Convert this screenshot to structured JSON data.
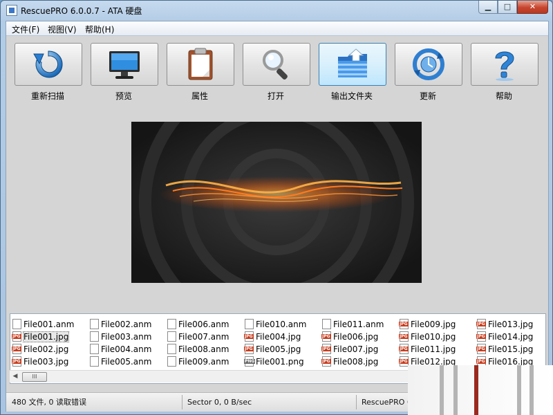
{
  "window": {
    "title": "RescuePRO 6.0.0.7 - ATA 硬盘",
    "controls": {
      "minimize": "▁",
      "maximize": "□",
      "close": "✕"
    }
  },
  "menu": [
    "文件(F)",
    "视图(V)",
    "帮助(H)"
  ],
  "toolbar": [
    {
      "label": "重新扫描",
      "icon": "rescan-icon"
    },
    {
      "label": "预览",
      "icon": "monitor-icon"
    },
    {
      "label": "属性",
      "icon": "clipboard-icon"
    },
    {
      "label": "打开",
      "icon": "magnifier-icon"
    },
    {
      "label": "输出文件夹",
      "icon": "output-folder-icon",
      "active": true
    },
    {
      "label": "更新",
      "icon": "update-icon"
    },
    {
      "label": "帮助",
      "icon": "help-icon"
    }
  ],
  "files": [
    [
      "File001.anm",
      "File001.jpg",
      "File002.jpg",
      "File003.jpg"
    ],
    [
      "File002.anm",
      "File003.anm",
      "File004.anm",
      "File005.anm"
    ],
    [
      "File006.anm",
      "File007.anm",
      "File008.anm",
      "File009.anm"
    ],
    [
      "File010.anm",
      "File004.jpg",
      "File005.jpg",
      "File001.png"
    ],
    [
      "File011.anm",
      "File006.jpg",
      "File007.jpg",
      "File008.jpg"
    ],
    [
      "File009.jpg",
      "File010.jpg",
      "File011.jpg",
      "File012.jpg"
    ],
    [
      "File013.jpg",
      "File014.jpg",
      "File015.jpg",
      "File016.jpg"
    ]
  ],
  "selected_file": "File001.jpg",
  "scrollbar": {
    "left_arrow": "◀",
    "thumb_grip": "III"
  },
  "status": {
    "files": "480 文件, 0 读取错误",
    "sector": "Sector 0, 0 B/sec",
    "app": "RescuePRO 6."
  },
  "colors": {
    "accent": "#3b8ed0",
    "close_button": "#c7452f"
  }
}
